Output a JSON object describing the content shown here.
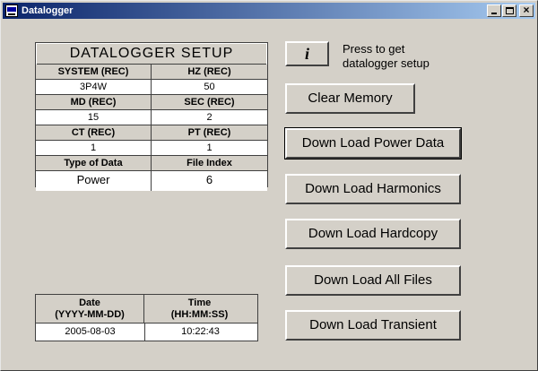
{
  "window": {
    "title": "Datalogger"
  },
  "setup": {
    "title": "DATALOGGER SETUP",
    "rows": [
      {
        "left_label": "SYSTEM (REC)",
        "right_label": "HZ (REC)",
        "left_value": "3P4W",
        "right_value": "50"
      },
      {
        "left_label": "MD (REC)",
        "right_label": "SEC (REC)",
        "left_value": "15",
        "right_value": "2"
      },
      {
        "left_label": "CT (REC)",
        "right_label": "PT (REC)",
        "left_value": "1",
        "right_value": "1"
      },
      {
        "left_label": "Type of Data",
        "right_label": "File Index",
        "left_value": "Power",
        "right_value": "6"
      }
    ]
  },
  "datetime": {
    "date_header_line1": "Date",
    "date_header_line2": "(YYYY-MM-DD)",
    "time_header_line1": "Time",
    "time_header_line2": "(HH:MM:SS)",
    "date_value": "2005-08-03",
    "time_value": "10:22:43"
  },
  "info": {
    "button_label": "i",
    "label_line1": "Press to get",
    "label_line2": "datalogger setup"
  },
  "buttons": {
    "clear_memory": "Clear Memory",
    "power_data": "Down Load Power Data",
    "harmonics": "Down Load Harmonics",
    "hardcopy": "Down Load Hardcopy",
    "all_files": "Down Load All Files",
    "transient": "Down Load Transient"
  },
  "icons": {
    "app": "datalogger-app-icon",
    "minimize": "minimize-icon",
    "maximize": "maximize-icon",
    "close": "close-icon"
  }
}
